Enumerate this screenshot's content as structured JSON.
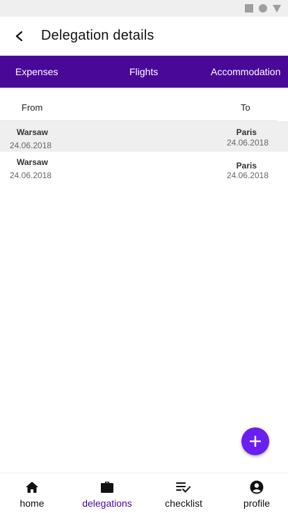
{
  "app_bar": {
    "title": "Delegation details"
  },
  "tabs": [
    {
      "label": "Expenses"
    },
    {
      "label": "Flights"
    },
    {
      "label": "Accommodation"
    }
  ],
  "table": {
    "headers": {
      "from": "From",
      "to": "To"
    },
    "rows": [
      {
        "from_city": "Warsaw",
        "from_date": "24.06.2018",
        "to_city": "Paris",
        "to_date": "24.06.2018"
      },
      {
        "from_city": "Warsaw",
        "from_date": "24.06.2018",
        "to_city": "Paris",
        "to_date": "24.06.2018"
      }
    ]
  },
  "fab": {
    "icon": "plus-icon"
  },
  "bottom_nav": {
    "items": [
      {
        "label": "home",
        "icon": "home-icon"
      },
      {
        "label": "delegations",
        "icon": "briefcase-icon",
        "active": true
      },
      {
        "label": "checklist",
        "icon": "checklist-icon"
      },
      {
        "label": "profile",
        "icon": "account-circle-icon"
      }
    ]
  },
  "colors": {
    "primary": "#4a0899",
    "accent": "#6a1ff0",
    "status_bar": "#efefef",
    "selected_row": "#efefef"
  }
}
